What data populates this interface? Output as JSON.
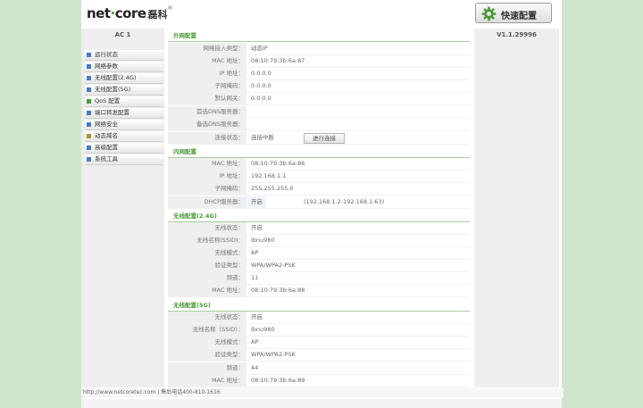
{
  "header": {
    "logo_main": "net",
    "logo_dot": "·",
    "logo_rest": "core",
    "logo_cn": "磊科",
    "logo_reg": "®",
    "quick_setup": "快速配置",
    "quick_icon": "gear-icon"
  },
  "sidebar": {
    "model": "AC 1",
    "items": [
      {
        "label": "运行状态",
        "icon": "blue"
      },
      {
        "label": "网络参数",
        "icon": "blue"
      },
      {
        "label": "无线配置(2.4G)",
        "icon": "blue"
      },
      {
        "label": "无线配置(5G)",
        "icon": "blue"
      },
      {
        "label": "QoS 配置",
        "icon": "green"
      },
      {
        "label": "端口转发配置",
        "icon": "blue"
      },
      {
        "label": "网络安全",
        "icon": "blue"
      },
      {
        "label": "动态域名",
        "icon": "yellow"
      },
      {
        "label": "高级配置",
        "icon": "blue"
      },
      {
        "label": "系统工具",
        "icon": "blue"
      }
    ]
  },
  "right": {
    "version": "V1.1.29996"
  },
  "wan": {
    "title": "外网配置",
    "rows": [
      {
        "label": "网络接入类型：",
        "value": "动态IP"
      },
      {
        "label": "MAC 地址：",
        "value": "08:10:79:3b:6a:87"
      },
      {
        "label": "IP 地址：",
        "value": "0.0.0.0"
      },
      {
        "label": "子网掩码：",
        "value": "0.0.0.0"
      },
      {
        "label": "默认网关：",
        "value": "0.0.0.0"
      },
      {
        "label": "首选DNS服务器：",
        "value": ""
      },
      {
        "label": "备选DNS服务器：",
        "value": ""
      }
    ],
    "status_label": "连接状态：",
    "status_value": "连接中断",
    "connect_button": "进行连接"
  },
  "lan": {
    "title": "内网配置",
    "rows": [
      {
        "label": "MAC 地址：",
        "value": "08:10:79:3b:6a:86"
      },
      {
        "label": "IP 地址：",
        "value": "192.168.1.1"
      },
      {
        "label": "子网掩码：",
        "value": "255.255.255.0"
      }
    ],
    "dhcp_label": "DHCP服务器：",
    "dhcp_value": "开启",
    "dhcp_range": "(192.168.1.2-192.168.1.63)"
  },
  "wifi24": {
    "title": "无线配置(2.4G)",
    "rows": [
      {
        "label": "无线状态：",
        "value": "开启"
      },
      {
        "label": "无线名称(SSID)：",
        "value": "ibnu980"
      },
      {
        "label": "无线模式：",
        "value": "AP"
      },
      {
        "label": "验证类型：",
        "value": "WPA/WPA2-PSK"
      },
      {
        "label": "频道：",
        "value": "11"
      },
      {
        "label": "MAC 地址：",
        "value": "08:10:79:3b:6a:88"
      }
    ]
  },
  "wifi5": {
    "title": "无线配置(5G)",
    "rows": [
      {
        "label": "无线状态：",
        "value": "开启"
      },
      {
        "label": "无线名称（SSID）：",
        "value": "ibnu980"
      },
      {
        "label": "无线模式：",
        "value": "AP"
      },
      {
        "label": "验证类型：",
        "value": "WPA/WPA2-PSK"
      },
      {
        "label": "频道：",
        "value": "44"
      },
      {
        "label": "MAC 地址：",
        "value": "08:10:79:3b:6a:89"
      }
    ]
  },
  "footer": {
    "text": "http://www.netcoretec.com | 售后电话400-810-1616"
  }
}
